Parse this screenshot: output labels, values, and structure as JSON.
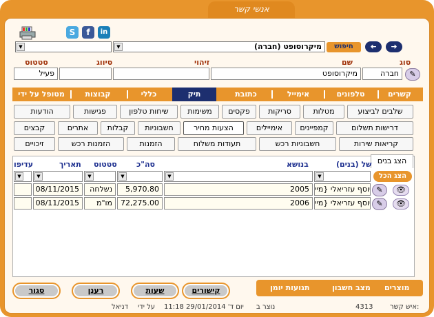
{
  "window": {
    "title": "אנשי קשר"
  },
  "toolbar": {
    "search_label": "חיפוש",
    "record_selector_value": "מיקרוסופט (חברה)",
    "secondary_selector_value": ""
  },
  "header_fields": {
    "type_label": "סוג",
    "type_value": "חברה",
    "name_label": "שם",
    "name_value": "מיקרוסופט",
    "id_label": "זיהוי",
    "id_value": "",
    "class_label": "סיווג",
    "class_value": "",
    "status_label": "סטטוס",
    "status_value": "פעיל"
  },
  "tabs": [
    {
      "label": "קשרים"
    },
    {
      "label": "טלפונים"
    },
    {
      "label": "אימייל"
    },
    {
      "label": "כתובת"
    },
    {
      "label": "תיק"
    },
    {
      "label": "כללי"
    },
    {
      "label": "קבוצות"
    },
    {
      "label": "מטופל על ידי"
    }
  ],
  "buttons_row1": [
    "שלבים לביצוע",
    "מטלות",
    "סריקות",
    "פקסים",
    "משימות",
    "שיחות טלפון",
    "פגישות",
    "הודעות"
  ],
  "buttons_row2": [
    "דרישות תשלום",
    "קמפיינים",
    "אימיילים",
    "הצעות מחיר",
    "חשבוניות",
    "קבלות",
    "אתרים",
    "קבצים"
  ],
  "buttons_row3": [
    "קריאות שירות",
    "חשבוניות רכש",
    "תעודות משלוח",
    "הזמנות",
    "הזמנות רכש",
    "זיכויים"
  ],
  "grid": {
    "show_children_tab": "הצג בנים",
    "show_all_button": "הצג הכל",
    "headers": {
      "of_children": "של (בנים)",
      "subject": "בנושא",
      "total": "סה\"כ",
      "status": "סטטוס",
      "date": "תאריך",
      "priority": "עדיפו"
    },
    "rows": [
      {
        "of_children": "יוסף עזריאלי {מיי",
        "subject": "2005",
        "total": "5,970.80",
        "status": "נשלחה",
        "date": "08/11/2015",
        "priority": ""
      },
      {
        "of_children": "יוסף עזריאלי {מיי",
        "subject": "2006",
        "total": "72,275.00",
        "status": "מו\"מ",
        "date": "08/11/2015",
        "priority": ""
      }
    ]
  },
  "bottom_bar": {
    "products": "מוצרים",
    "account_status": "מצב חשבון",
    "journal": "תנועות יומן"
  },
  "bottom_buttons": {
    "links": "קישורים",
    "hours": "שעות",
    "refresh": "רענן",
    "close": "סגור"
  },
  "status_line": {
    "contact_label": "איש קשר:",
    "contact_id": "4313",
    "created_label": "נוצר ב",
    "created_date": "יום ד' 29/01/2014 11:18",
    "by_label": "על ידי",
    "by_user": "דניאל"
  }
}
